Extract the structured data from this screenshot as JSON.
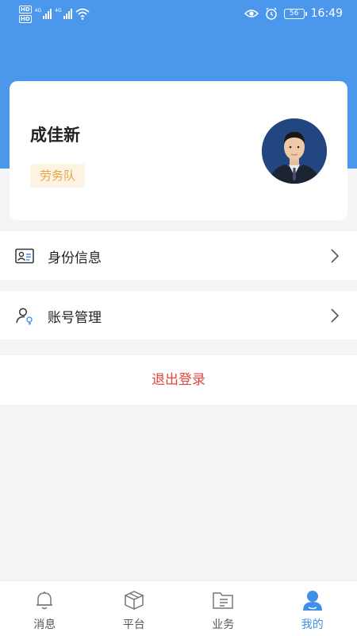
{
  "status_bar": {
    "sim1": "HD",
    "sim2": "HD",
    "net1": "4G",
    "net2": "4G",
    "battery": "56",
    "time": "16:49",
    "icons": [
      "eye-icon",
      "alarm-icon",
      "battery-icon",
      "wifi-icon",
      "signal-icon"
    ]
  },
  "profile": {
    "name": "成佳新",
    "tag": "劳务队",
    "avatar_icon": "user-photo-icon"
  },
  "menu": {
    "identity": {
      "label": "身份信息",
      "icon": "id-card-icon"
    },
    "account": {
      "label": "账号管理",
      "icon": "user-key-icon"
    },
    "logout": "退出登录"
  },
  "tabs": [
    {
      "label": "消息",
      "icon": "bell-icon",
      "active": false
    },
    {
      "label": "平台",
      "icon": "box-icon",
      "active": false
    },
    {
      "label": "业务",
      "icon": "folder-icon",
      "active": false
    },
    {
      "label": "我的",
      "icon": "person-icon",
      "active": true
    }
  ],
  "colors": {
    "header_blue": "#4a97ec",
    "accent_blue": "#3f8fe6",
    "logout_red": "#e0483f",
    "tag_bg": "#fdf4e3",
    "tag_text": "#e2a648"
  }
}
